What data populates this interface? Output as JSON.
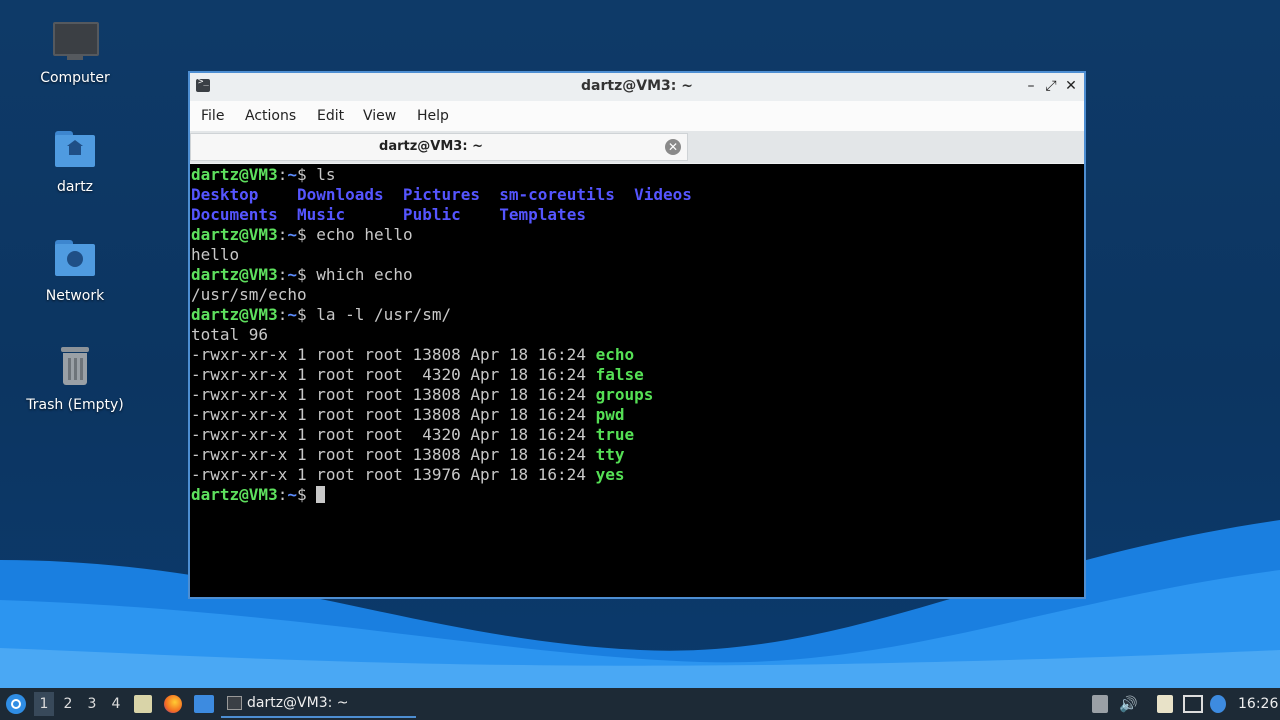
{
  "desktop": {
    "icons": [
      {
        "label": "Computer"
      },
      {
        "label": "dartz"
      },
      {
        "label": "Network"
      },
      {
        "label": "Trash (Empty)"
      }
    ]
  },
  "window": {
    "title": "dartz@VM3: ~",
    "menu": [
      "File",
      "Actions",
      "Edit",
      "View",
      "Help"
    ],
    "tab_label": "dartz@VM3: ~",
    "controls": {
      "minimize": "–",
      "maximize": "⤢",
      "close": "✕"
    }
  },
  "terminal": {
    "prompt_user": "dartz@VM3",
    "prompt_sep": ":",
    "prompt_path": "~",
    "prompt_sym": "$ ",
    "lines": [
      {
        "type": "cmd",
        "text": "ls"
      },
      {
        "type": "dirs",
        "items": [
          "Desktop   ",
          " Downloads ",
          " Pictures ",
          " sm-coreutils ",
          " Videos"
        ]
      },
      {
        "type": "dirs",
        "items": [
          "Documents ",
          " Music     ",
          " Public   ",
          " Templates"
        ]
      },
      {
        "type": "cmd",
        "text": "echo hello"
      },
      {
        "type": "out",
        "text": "hello"
      },
      {
        "type": "cmd",
        "text": "which echo"
      },
      {
        "type": "out",
        "text": "/usr/sm/echo"
      },
      {
        "type": "cmd",
        "text": "la -l /usr/sm/"
      },
      {
        "type": "out",
        "text": "total 96"
      },
      {
        "type": "ls",
        "perm": "-rwxr-xr-x 1 root root 13808 Apr 18 16:24 ",
        "name": "echo"
      },
      {
        "type": "ls",
        "perm": "-rwxr-xr-x 1 root root  4320 Apr 18 16:24 ",
        "name": "false"
      },
      {
        "type": "ls",
        "perm": "-rwxr-xr-x 1 root root 13808 Apr 18 16:24 ",
        "name": "groups"
      },
      {
        "type": "ls",
        "perm": "-rwxr-xr-x 1 root root 13808 Apr 18 16:24 ",
        "name": "pwd"
      },
      {
        "type": "ls",
        "perm": "-rwxr-xr-x 1 root root  4320 Apr 18 16:24 ",
        "name": "true"
      },
      {
        "type": "ls",
        "perm": "-rwxr-xr-x 1 root root 13808 Apr 18 16:24 ",
        "name": "tty"
      },
      {
        "type": "ls",
        "perm": "-rwxr-xr-x 1 root root 13976 Apr 18 16:24 ",
        "name": "yes"
      },
      {
        "type": "cmd",
        "text": "",
        "cursor": true
      }
    ]
  },
  "taskbar": {
    "workspaces": [
      "1",
      "2",
      "3",
      "4"
    ],
    "active_workspace": "1",
    "task_label": "dartz@VM3: ~",
    "clock": "16:26"
  },
  "colors": {
    "accent": "#4d8ed2",
    "prompt_user": "#5ee05e",
    "directory": "#5555ff",
    "executable": "#55e055"
  }
}
